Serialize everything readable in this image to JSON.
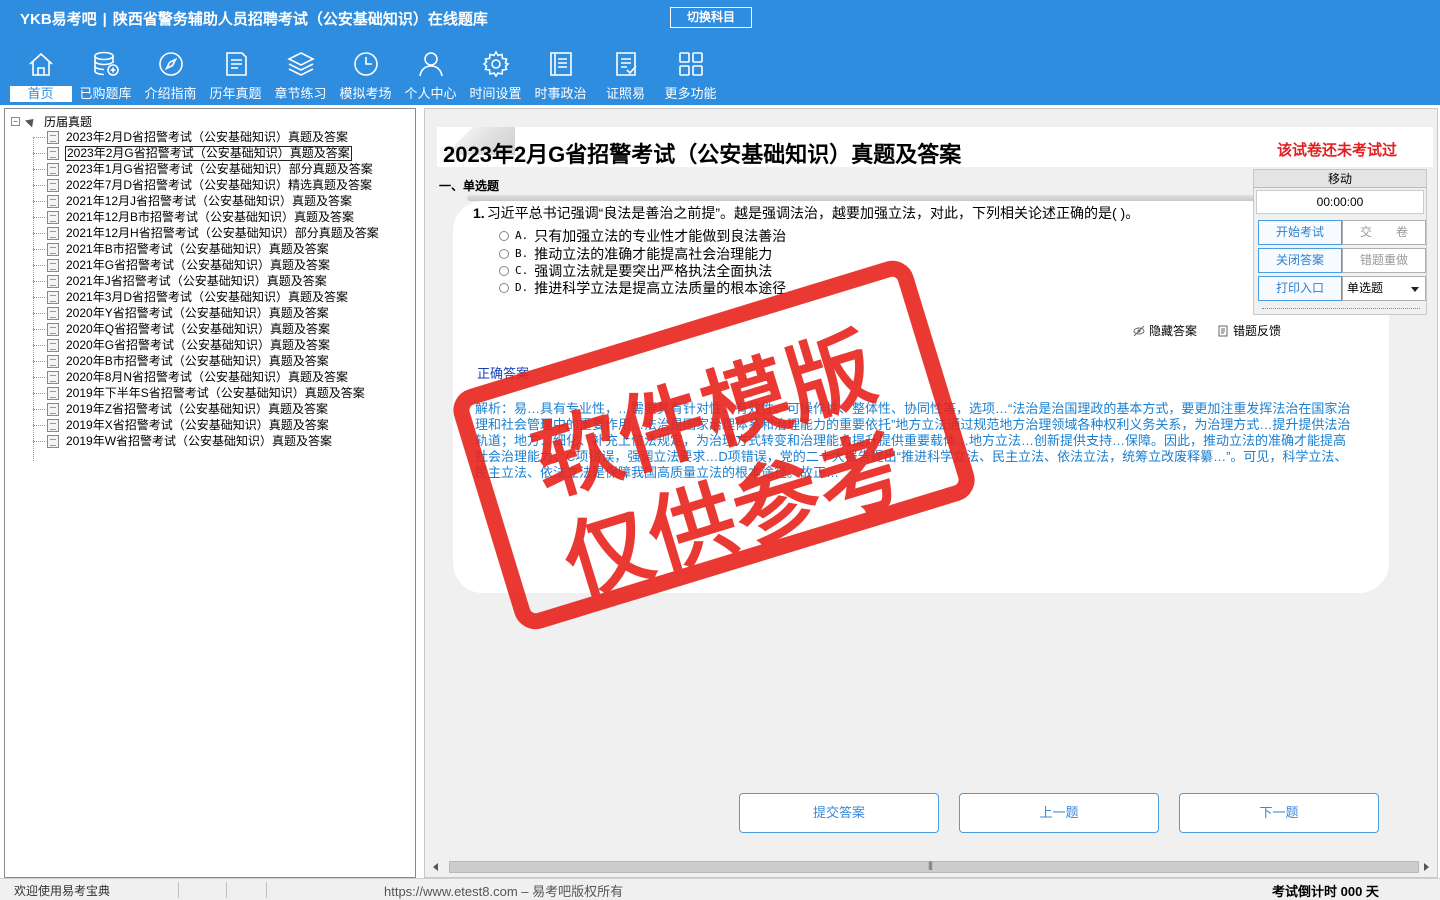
{
  "header": {
    "logo": "YKB易考吧",
    "title": "陕西省警务辅助人员招聘考试（公安基础知识）在线题库",
    "switch_subject": "切换科目"
  },
  "nav": [
    {
      "label": "首页",
      "icon": "home-icon"
    },
    {
      "label": "已购题库",
      "icon": "database-icon"
    },
    {
      "label": "介绍指南",
      "icon": "compass-icon"
    },
    {
      "label": "历年真题",
      "icon": "document-icon"
    },
    {
      "label": "章节练习",
      "icon": "layers-icon"
    },
    {
      "label": "模拟考场",
      "icon": "clock-icon"
    },
    {
      "label": "个人中心",
      "icon": "user-icon"
    },
    {
      "label": "时间设置",
      "icon": "gear-icon"
    },
    {
      "label": "时事政治",
      "icon": "notebook-icon"
    },
    {
      "label": "证照易",
      "icon": "checklist-icon"
    },
    {
      "label": "更多功能",
      "icon": "grid-icon"
    }
  ],
  "tree": {
    "root": "历届真题",
    "items": [
      "2023年2月D省招警考试（公安基础知识）真题及答案",
      "2023年2月G省招警考试（公安基础知识）真题及答案",
      "2023年1月G省招警考试（公安基础知识）部分真题及答案",
      "2022年7月D省招警考试（公安基础知识）精选真题及答案",
      "2021年12月J省招警考试（公安基础知识）真题及答案",
      "2021年12月B市招警考试（公安基础知识）真题及答案",
      "2021年12月H省招警考试（公安基础知识）部分真题及答案",
      "2021年B市招警考试（公安基础知识）真题及答案",
      "2021年G省招警考试（公安基础知识）真题及答案",
      "2021年J省招警考试（公安基础知识）真题及答案",
      "2021年3月D省招警考试（公安基础知识）真题及答案",
      "2020年Y省招警考试（公安基础知识）真题及答案",
      "2020年Q省招警考试（公安基础知识）真题及答案",
      "2020年G省招警考试（公安基础知识）真题及答案",
      "2020年B市招警考试（公安基础知识）真题及答案",
      "2020年8月N省招警考试（公安基础知识）真题及答案",
      "2019年下半年S省招警考试（公安基础知识）真题及答案",
      "2019年Z省招警考试（公安基础知识）真题及答案",
      "2019年X省招警考试（公安基础知识）真题及答案",
      "2019年W省招警考试（公安基础知识）真题及答案"
    ],
    "selected_index": 1
  },
  "paper": {
    "title": "2023年2月G省招警考试（公安基础知识）真题及答案",
    "status": "该试卷还未考试过",
    "section": "一、单选题"
  },
  "question": {
    "number": "1.",
    "stem": "习近平总书记强调“良法是善治之前提”。越是强调法治，越要加强立法，对此，下列相关论述正确的是( )。",
    "options": [
      {
        "letter": "A.",
        "text": "只有加强立法的专业性才能做到良法善治"
      },
      {
        "letter": "B.",
        "text": "推动立法的准确才能提高社会治理能力"
      },
      {
        "letter": "C.",
        "text": "强调立法就是要突出严格执法全面执法"
      },
      {
        "letter": "D.",
        "text": "推进科学立法是提高立法质量的根本途径"
      }
    ],
    "hide_answer": "隐藏答案",
    "error_feedback": "错题反馈",
    "answer_label": "正确答案",
    "analysis": "解析：易…具有专业性，…需要具有针对性、有效性、可操作性、整体性、协同性等，选项…“法治是治国理政的基本方式，要更加注重发挥法治在国家治理和社会管理中的重要作用…法治是国家治理体系和治理能力的重要依托”地方立法通过规范地方治理领域各种权利义务关系，为治理方式…提升提供法治轨道；地方…细化、补充上位法规定，为治理方式转变和治理能力提升提供重要载体…地方立法…创新提供支持…保障。因此，推动立法的准确才能提高社会治理能力，C项错误，强调立法要求…D项错误，党的二十大报告提出“推进科学立法、民主立法、依法立法，统筹立改废释纂…”。可见，科学立法、民主立法、依法立法是保障我国高质量立法的根本途径。故正…"
  },
  "timer_panel": {
    "move": "移动",
    "time": "00:00:00",
    "start_exam": "开始考试",
    "submit_paper": "交　　卷",
    "close_answer": "关闭答案",
    "redo_wrong": "错题重做",
    "print_entry": "打印入口",
    "question_type": "单选题"
  },
  "bottom_buttons": {
    "submit": "提交答案",
    "prev": "上一题",
    "next": "下一题"
  },
  "watermark": {
    "line1": "软件模版",
    "line2": "仅供参考"
  },
  "statusbar": {
    "welcome": "欢迎使用易考宝典",
    "site": "https://www.etest8.com – 易考吧版权所有",
    "countdown": "考试倒计时 000 天"
  },
  "colors": {
    "header_bg": "#2f8de0",
    "alert_red": "#e02020",
    "link_blue": "#1a7fd0",
    "stamp_red": "#e8241c"
  }
}
